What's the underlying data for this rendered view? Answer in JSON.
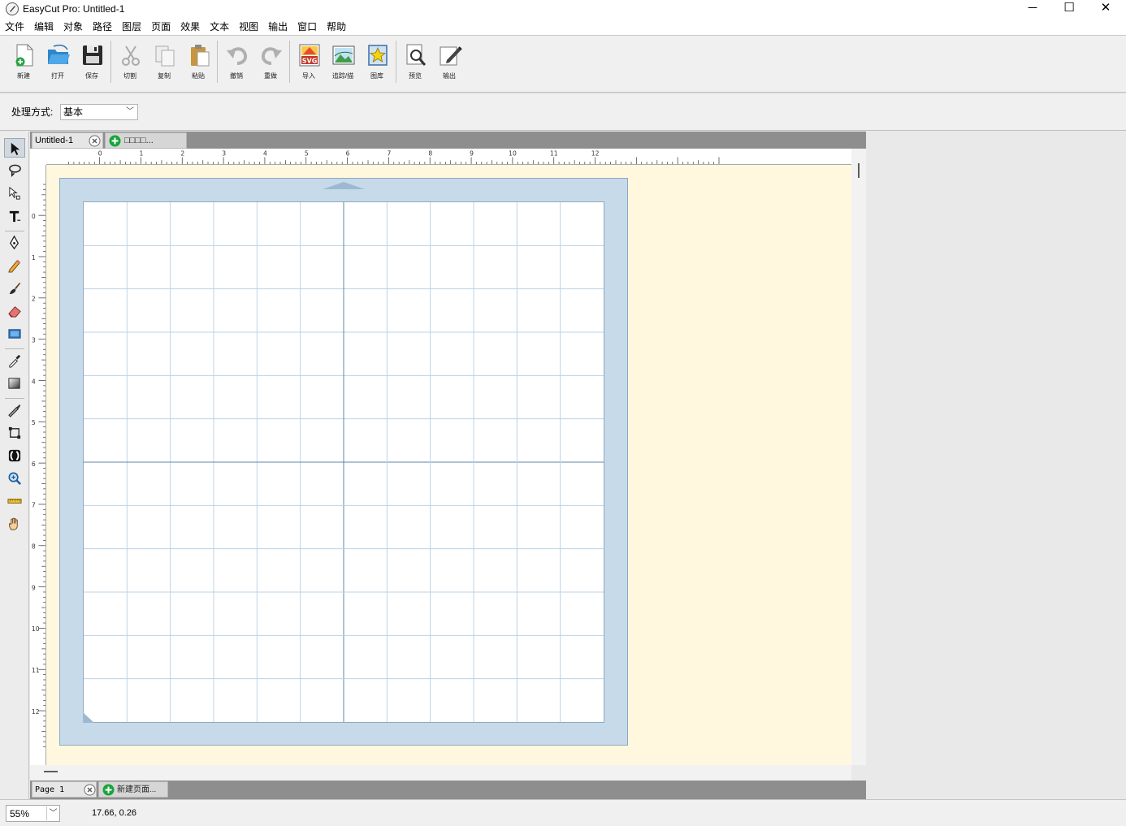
{
  "window": {
    "title": "EasyCut Pro: Untitled-1",
    "minimize_glyph": "─",
    "maximize_glyph": "☐",
    "close_glyph": "✕"
  },
  "menu": [
    {
      "label": "文件",
      "name": "menu-file"
    },
    {
      "label": "编辑",
      "name": "menu-edit"
    },
    {
      "label": "对象",
      "name": "menu-object"
    },
    {
      "label": "路径",
      "name": "menu-path"
    },
    {
      "label": "图层",
      "name": "menu-layer"
    },
    {
      "label": "页面",
      "name": "menu-page"
    },
    {
      "label": "效果",
      "name": "menu-effects"
    },
    {
      "label": "文本",
      "name": "menu-text"
    },
    {
      "label": "视图",
      "name": "menu-view"
    },
    {
      "label": "输出",
      "name": "menu-output"
    },
    {
      "label": "窗口",
      "name": "menu-window"
    },
    {
      "label": "帮助",
      "name": "menu-help"
    }
  ],
  "toolbar": {
    "buttons": [
      {
        "label": "新建",
        "name": "new-button",
        "icon": "new-doc-icon",
        "enabled": true
      },
      {
        "label": "打开",
        "name": "open-button",
        "icon": "open-folder-icon",
        "enabled": true
      },
      {
        "label": "保存",
        "name": "save-button",
        "icon": "save-disk-icon",
        "enabled": true
      },
      {
        "sep": true
      },
      {
        "label": "切割",
        "name": "cut-button",
        "icon": "scissors-icon",
        "enabled": false
      },
      {
        "label": "复制",
        "name": "copy-button",
        "icon": "copy-icon",
        "enabled": false
      },
      {
        "label": "粘贴",
        "name": "paste-button",
        "icon": "paste-icon",
        "enabled": true
      },
      {
        "sep": true
      },
      {
        "label": "撤销",
        "name": "undo-button",
        "icon": "undo-icon",
        "enabled": false
      },
      {
        "label": "重做",
        "name": "redo-button",
        "icon": "redo-icon",
        "enabled": false
      },
      {
        "sep": true
      },
      {
        "label": "导入",
        "name": "import-button",
        "icon": "svg-import-icon",
        "enabled": true
      },
      {
        "label": "追踪/描",
        "name": "trace-button",
        "icon": "trace-image-icon",
        "enabled": true
      },
      {
        "label": "图库",
        "name": "library-button",
        "icon": "library-star-icon",
        "enabled": true
      },
      {
        "sep": true
      },
      {
        "label": "预览",
        "name": "preview-button",
        "icon": "preview-magnifier-icon",
        "enabled": true
      },
      {
        "label": "输出",
        "name": "output-button",
        "icon": "output-pen-icon",
        "enabled": true
      }
    ]
  },
  "process": {
    "label": "处理方式:",
    "value": "基本",
    "arrow": "﹀"
  },
  "tools": [
    {
      "name": "select-tool",
      "icon": "arrow-pointer-icon",
      "active": true
    },
    {
      "name": "lasso-tool",
      "icon": "lasso-icon"
    },
    {
      "name": "node-select-tool",
      "icon": "node-arrow-icon"
    },
    {
      "name": "text-tool",
      "icon": "text-t-icon"
    },
    {
      "sep": true
    },
    {
      "name": "pen-tool",
      "icon": "pen-nib-icon"
    },
    {
      "name": "pencil-tool",
      "icon": "pencil-icon"
    },
    {
      "name": "brush-tool",
      "icon": "brush-icon"
    },
    {
      "name": "eraser-tool",
      "icon": "eraser-icon"
    },
    {
      "name": "rectangle-tool",
      "icon": "rectangle-icon"
    },
    {
      "sep": true
    },
    {
      "name": "eyedropper-tool",
      "icon": "eyedropper-icon"
    },
    {
      "name": "gradient-tool",
      "icon": "gradient-icon"
    },
    {
      "sep": true
    },
    {
      "name": "knife-tool",
      "icon": "knife-icon"
    },
    {
      "name": "transform-tool",
      "icon": "transform-icon"
    },
    {
      "name": "weld-tool",
      "icon": "weld-icon"
    },
    {
      "name": "zoom-tool",
      "icon": "zoom-icon"
    },
    {
      "name": "measure-tool",
      "icon": "ruler-icon"
    },
    {
      "name": "pan-tool",
      "icon": "hand-icon"
    }
  ],
  "document": {
    "tab_label": "Untitled-1",
    "new_tab_label": "□□□□...",
    "ruler_h": [
      "0",
      "1",
      "2",
      "3",
      "4",
      "5",
      "6",
      "7",
      "8",
      "9",
      "10",
      "11",
      "12"
    ],
    "ruler_v": [
      "0",
      "1",
      "2",
      "3",
      "4",
      "5",
      "6",
      "7",
      "8",
      "9",
      "10",
      "11",
      "12"
    ],
    "mat_color": "#c7dae9",
    "canvas_color": "#fff8df"
  },
  "pages": {
    "page_label": "Page  1",
    "new_page_label": "新建页面..."
  },
  "status": {
    "zoom": "55%",
    "coordinates": "17.66, 0.26"
  }
}
